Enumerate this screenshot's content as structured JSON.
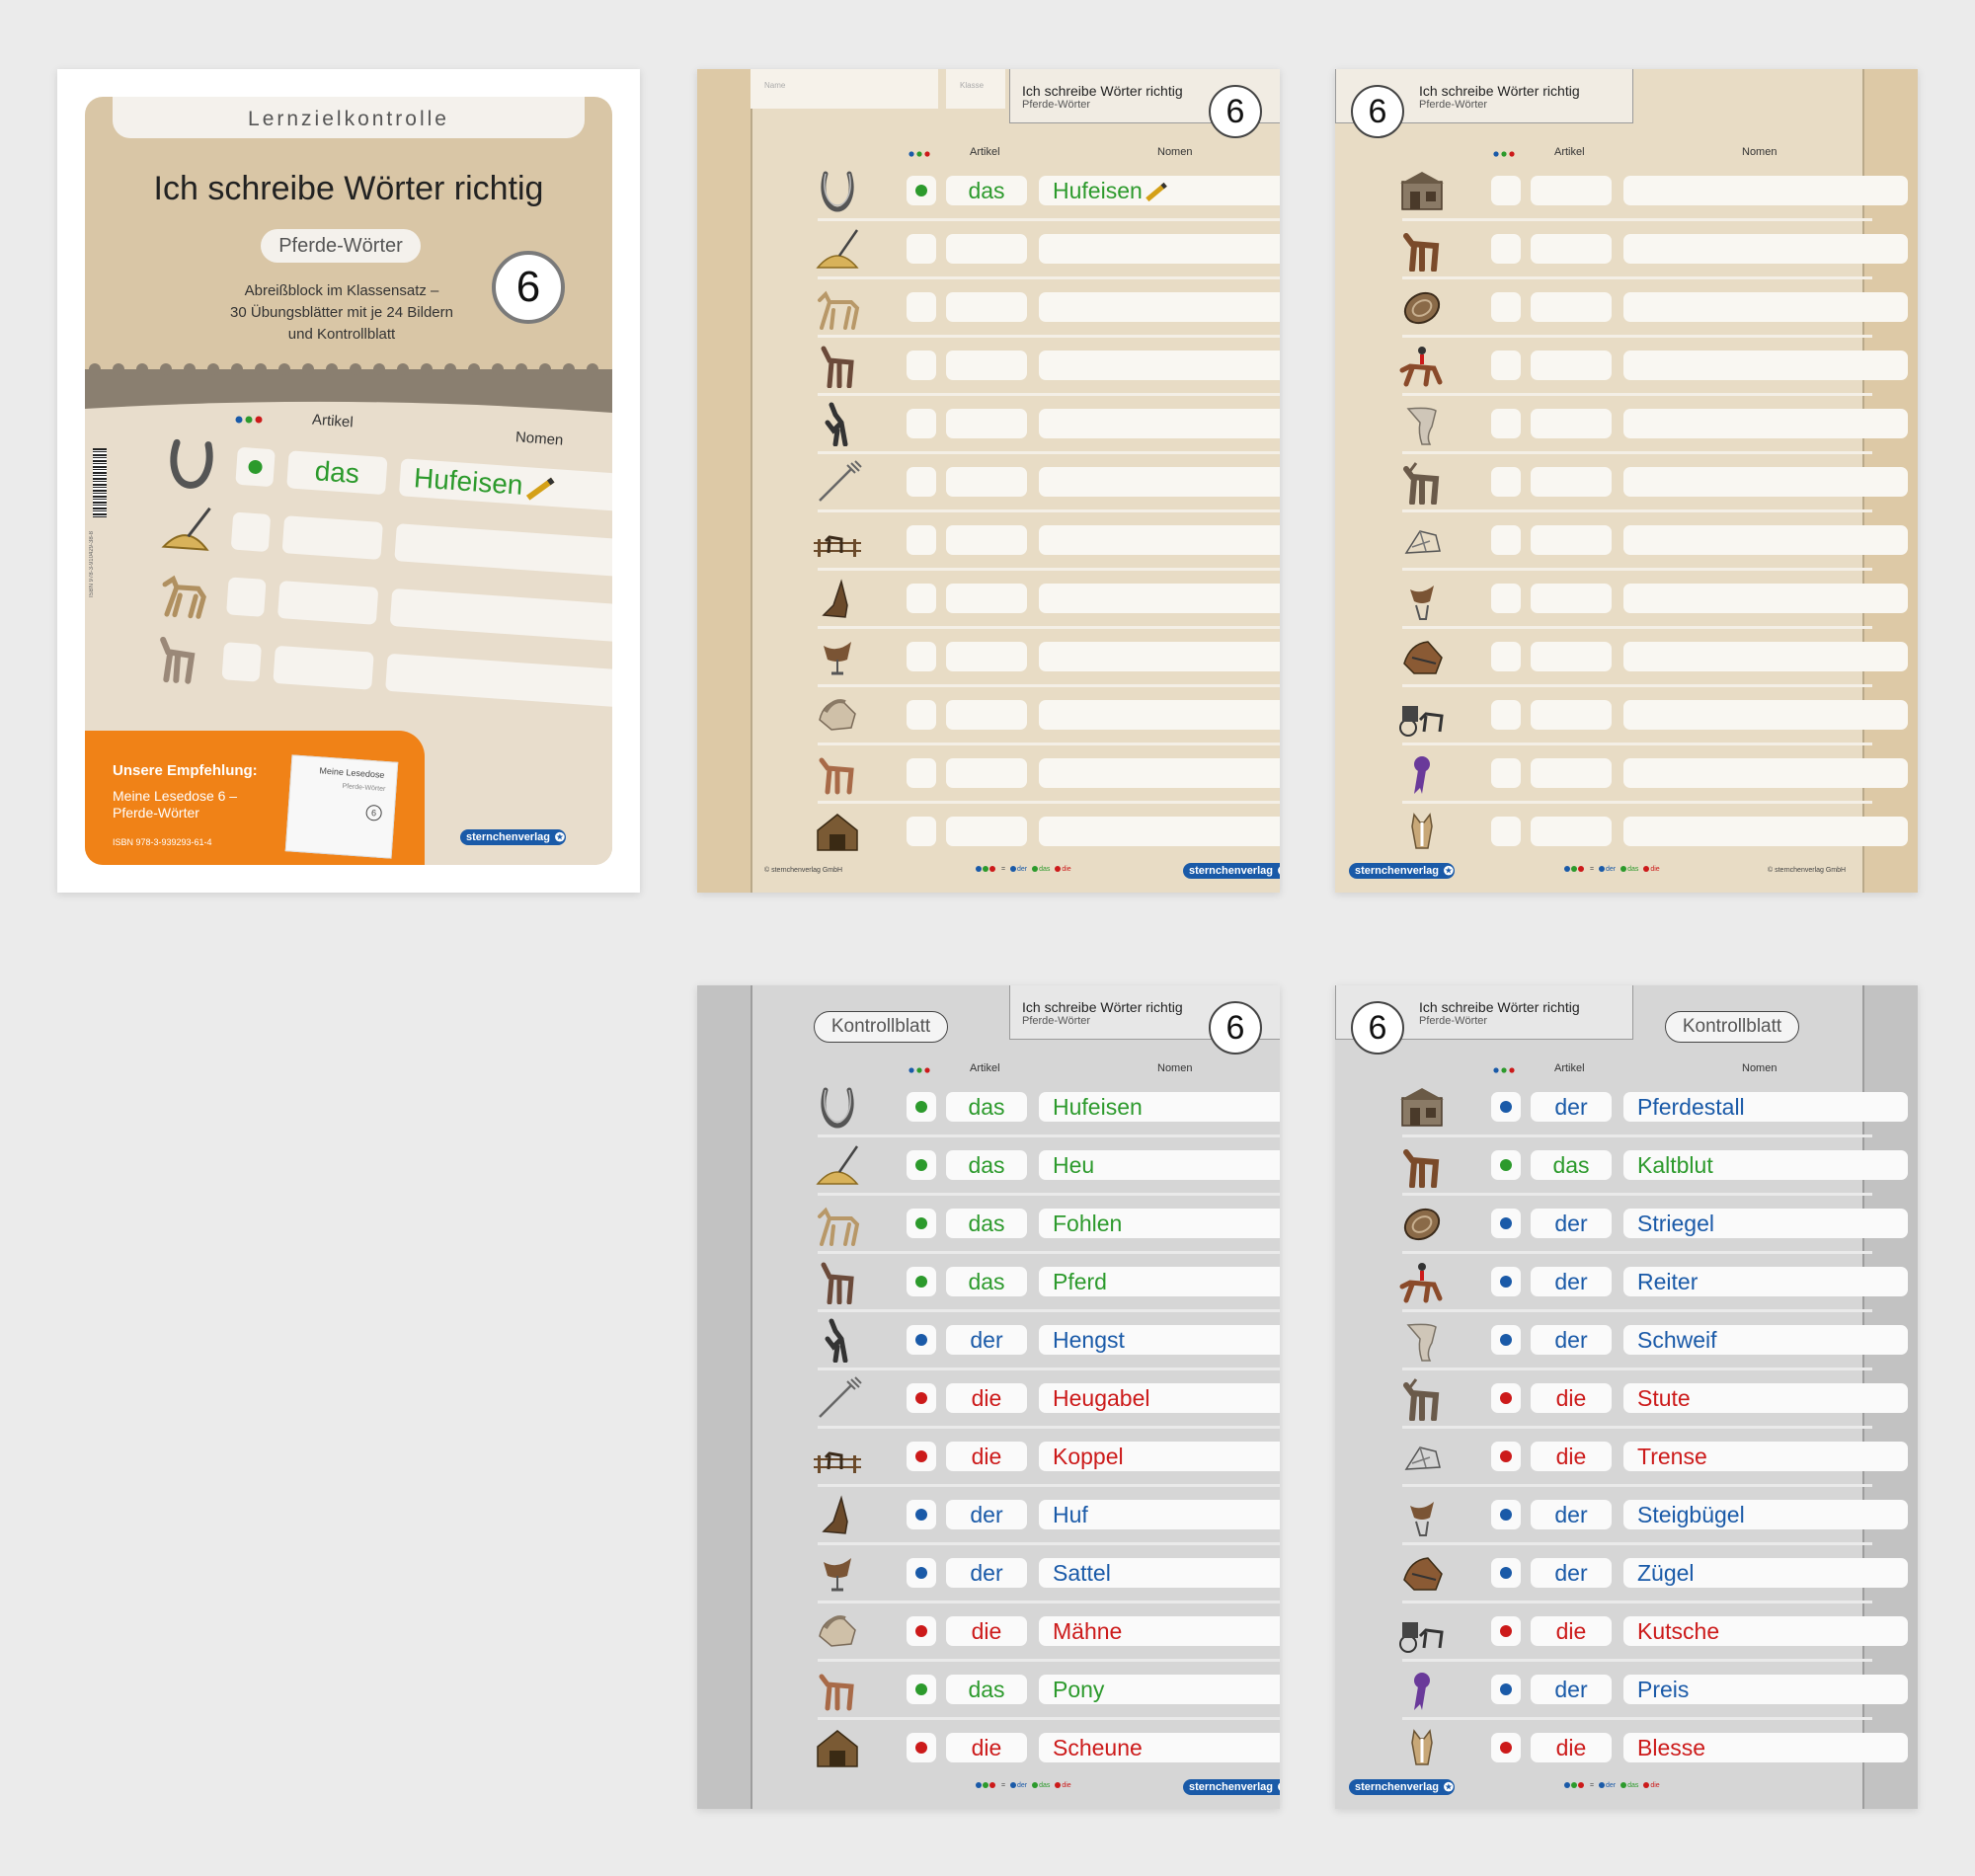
{
  "cover": {
    "tab": "Lernzielkontrolle",
    "title": "Ich schreibe Wörter richtig",
    "subtitle": "Pferde-Wörter",
    "desc_lines": [
      "Abreißblock im Klassensatz –",
      "30 Übungsblätter mit je 24 Bildern",
      "und Kontrollblatt"
    ],
    "number": "6",
    "col_artikel": "Artikel",
    "col_nomen": "Nomen",
    "example_article": "das",
    "example_noun": "Hufeisen",
    "isbn_side": "ISBN 978-3-910429-38-8",
    "promo_heading": "Unsere Empfehlung:",
    "promo_lines": [
      "Meine Lesedose 6 –",
      "Pferde-Wörter"
    ],
    "promo_isbn": "ISBN 978-3-939293-61-4",
    "promo_book_title": "Meine Lesedose",
    "promo_book_sub": "Pferde-Wörter",
    "promo_book_num": "6",
    "logo": "sternchenverlag"
  },
  "common": {
    "header_title": "Ich schreibe Wörter richtig",
    "header_sub": "Pferde-Wörter",
    "number": "6",
    "col_artikel": "Artikel",
    "col_nomen": "Nomen",
    "name_label": "Name",
    "class_label": "Klasse",
    "copyright": "© sternchenverlag GmbH",
    "kontroll": "Kontrollblatt",
    "logo": "sternchenverlag",
    "legend_eq": "=",
    "legend_der": "der",
    "legend_das": "das",
    "legend_die": "die"
  },
  "colors": {
    "green": "#2c9a2c",
    "blue": "#1a5aa8",
    "red": "#cc1a1a",
    "beige": "#e8dcc5",
    "grey": "#d6d6d6",
    "orange": "#f08217"
  },
  "sheet1_rows": [
    {
      "icon": "horseshoe-icon",
      "color": "green",
      "article": "das",
      "noun": "Hufeisen"
    },
    {
      "icon": "hay-icon",
      "color": "green",
      "article": "das",
      "noun": "Heu"
    },
    {
      "icon": "foal-icon",
      "color": "green",
      "article": "das",
      "noun": "Fohlen"
    },
    {
      "icon": "horse-icon",
      "color": "green",
      "article": "das",
      "noun": "Pferd"
    },
    {
      "icon": "stallion-icon",
      "color": "blue",
      "article": "der",
      "noun": "Hengst"
    },
    {
      "icon": "pitchfork-icon",
      "color": "red",
      "article": "die",
      "noun": "Heugabel"
    },
    {
      "icon": "paddock-icon",
      "color": "red",
      "article": "die",
      "noun": "Koppel"
    },
    {
      "icon": "hoof-icon",
      "color": "blue",
      "article": "der",
      "noun": "Huf"
    },
    {
      "icon": "saddle-icon",
      "color": "blue",
      "article": "der",
      "noun": "Sattel"
    },
    {
      "icon": "mane-icon",
      "color": "red",
      "article": "die",
      "noun": "Mähne"
    },
    {
      "icon": "pony-icon",
      "color": "green",
      "article": "das",
      "noun": "Pony"
    },
    {
      "icon": "barn-icon",
      "color": "red",
      "article": "die",
      "noun": "Scheune"
    }
  ],
  "sheet2_rows": [
    {
      "icon": "stable-icon",
      "color": "blue",
      "article": "der",
      "noun": "Pferdestall"
    },
    {
      "icon": "coldblood-horse-icon",
      "color": "green",
      "article": "das",
      "noun": "Kaltblut"
    },
    {
      "icon": "curry-comb-icon",
      "color": "blue",
      "article": "der",
      "noun": "Striegel"
    },
    {
      "icon": "rider-icon",
      "color": "blue",
      "article": "der",
      "noun": "Reiter"
    },
    {
      "icon": "tail-icon",
      "color": "blue",
      "article": "der",
      "noun": "Schweif"
    },
    {
      "icon": "mare-icon",
      "color": "red",
      "article": "die",
      "noun": "Stute"
    },
    {
      "icon": "bridle-icon",
      "color": "red",
      "article": "die",
      "noun": "Trense"
    },
    {
      "icon": "stirrup-icon",
      "color": "blue",
      "article": "der",
      "noun": "Steigbügel"
    },
    {
      "icon": "reins-icon",
      "color": "blue",
      "article": "der",
      "noun": "Zügel"
    },
    {
      "icon": "carriage-icon",
      "color": "red",
      "article": "die",
      "noun": "Kutsche"
    },
    {
      "icon": "rosette-icon",
      "color": "blue",
      "article": "der",
      "noun": "Preis"
    },
    {
      "icon": "blaze-icon",
      "color": "red",
      "article": "die",
      "noun": "Blesse"
    }
  ]
}
